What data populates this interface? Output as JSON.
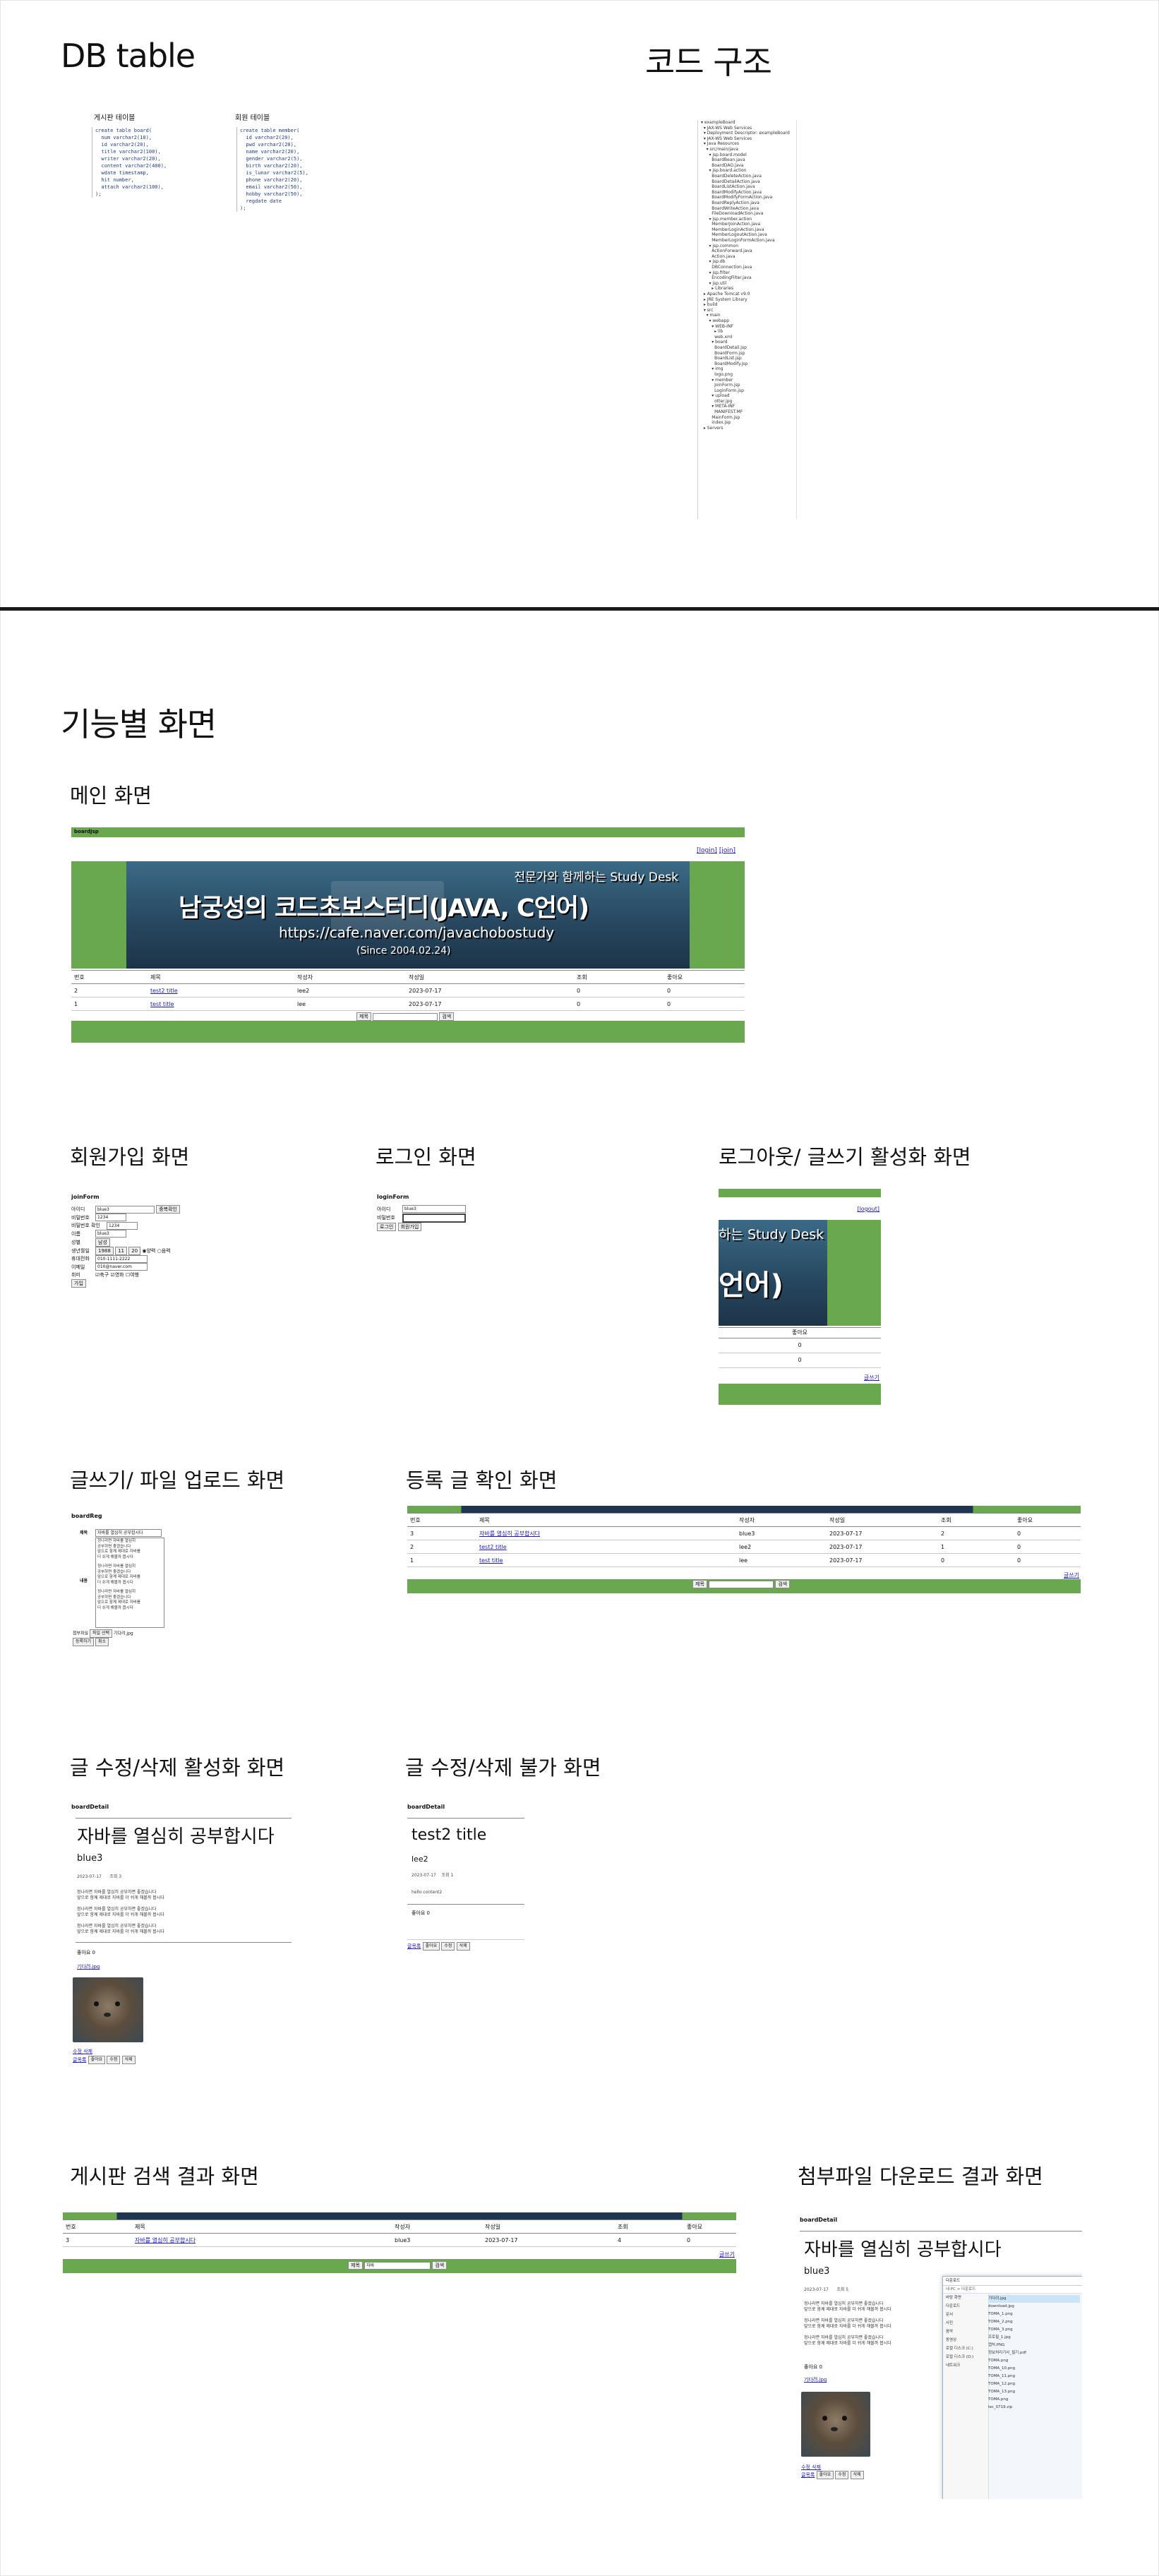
{
  "sections": {
    "db_title": "DB table",
    "code_title": "코드 구조",
    "feature_title": "기능별 화면",
    "main_screen": "메인 화면",
    "join_screen": "회원가입 화면",
    "login_screen": "로그인 화면",
    "logout_screen": "로그아웃/ 글쓰기 활성화 화면",
    "write_screen": "글쓰기/ 파일 업로드 화면",
    "registered_screen": "등록 글 확인 화면",
    "edit_enabled_screen": "글 수정/삭제 활성화  화면",
    "edit_disabled_screen": "글 수정/삭제 불가 화면",
    "search_screen": "게시판 검색 결과 화면",
    "download_screen": "첨부파일 다운로드 결과 화면"
  },
  "db": {
    "board_label": "게시판 테이블",
    "member_label": "회원 테이블",
    "board_sql": "create table board(\n  num varchar2(10),\n  id varchar2(20),\n  title varchar2(100),\n  writer varchar2(20),\n  content varchar2(400),\n  wdate timestamp,\n  hit number,\n  attach varchar2(100),\n);",
    "member_sql": "create table member(\n  id varchar2(20),\n  pwd varchar2(20),\n  name varchar2(20),\n  gender varchar2(5),\n  birth varchar2(20),\n  is_lunar varchar2(5),\n  phone varchar2(20),\n  email varchar2(50),\n  hobby varchar2(50),\n  regdate date\n);"
  },
  "code_tree": "▾ exampleBoard\n  ▾ JAX-WS Web Services\n  ▾ Deployment Descriptor: exampleBoard\n  ▾ JAX-WS Web Services\n  ▾ Java Resources\n    ▾ src/main/java\n      ▾ jsp.board.model\n        BoardBean.java\n        BoardDAO.java\n      ▾ jsp.board.action\n        BoardDeleteAction.java\n        BoardDetailAction.java\n        BoardListAction.java\n        BoardModifyAction.java\n        BoardModifyFormAction.java\n        BoardReplyAction.java\n        BoardWriteAction.java\n        FileDownloadAction.java\n      ▾ jsp.member.action\n        MemberJoinAction.java\n        MemberLoginAction.java\n        MemberLogoutAction.java\n        MemberLoginFormAction.java\n      ▾ jsp.common\n        ActionForward.java\n        Action.java\n      ▾ jsp.db\n        DBConnection.java\n      ▾ jsp.filter\n        EncodingFilter.java\n      ▾ jsp.util\n        ▸ Libraries\n  ▸ Apache Tomcat v9.0\n  ▸ JRE System Library\n  ▸ build\n  ▾ src\n    ▾ main\n      ▾ webapp\n        ▾ WEB-INF\n          ▸ lib\n          web.xml\n        ▾ board\n          BoardDetail.jsp\n          BoardForm.jsp\n          BoardList.jsp\n          BoardModify.jsp\n        ▾ img\n          logo.png\n        ▾ member\n          JoinForm.jsp\n          LoginForm.jsp\n        ▾ upload\n          otter.jpg\n        ▾ META-INF\n          MANIFEST.MF\n        MainForm.jsp\n        index.jsp\n  ▸ Servers",
  "main": {
    "brand": "boardJsp",
    "login_link": "[login]",
    "join_link": "[join]",
    "banner_tagline": "전문가와 함께하는 Study Desk",
    "banner_title": "남궁성의 코드초보스터디(JAVA, C언어)",
    "banner_url": "https://cafe.naver.com/javachobostudy",
    "banner_since": "(Since 2004.02.24)",
    "headers": [
      "번호",
      "제목",
      "작성자",
      "작성일",
      "조회",
      "좋아요"
    ],
    "rows": [
      [
        "2",
        "test2 title",
        "lee2",
        "2023-07-17",
        "0",
        "0"
      ],
      [
        "1",
        "test title",
        "lee",
        "2023-07-17",
        "0",
        "0"
      ]
    ],
    "search_select": "제목",
    "search_button": "검색"
  },
  "join": {
    "title": "joinForm",
    "id_label": "아이디",
    "id_value": "blue3",
    "dup_button": "중복확인",
    "pw_label": "비밀번호",
    "pw_value": "1234",
    "pw2_label": "비밀번호 확인",
    "pw2_value": "1234",
    "name_label": "이름",
    "name_value": "blue3",
    "gender_label": "성별",
    "gender_value": "남성",
    "birth_label": "생년월일",
    "birth_year": "1988",
    "birth_month": "11",
    "birth_day": "20",
    "solar": "양력",
    "lunar": "음력",
    "phone_label": "휴대전화",
    "phone_value": "010-1111-2222",
    "email_label": "이메일",
    "email_value": "010@naver.com",
    "hobby_label": "취미",
    "hobby_1": "축구",
    "hobby_2": "영화",
    "hobby_3": "여행",
    "submit": "가입"
  },
  "login": {
    "title": "loginForm",
    "id_label": "아이디",
    "id_value": "blue3",
    "pw_label": "비밀번호",
    "login_button": "로그인",
    "join_button": "회원가입"
  },
  "logout": {
    "logout_link": "[logout]",
    "banner_fragment": "하는 Study Desk",
    "banner_title_fragment": "언어)",
    "header": "좋아요",
    "vals": [
      "0",
      "0"
    ],
    "write_link": "글쓰기"
  },
  "write": {
    "title": "boardReg",
    "title_label": "제목",
    "title_value": "자바를 열심히 공부합시다",
    "content_label": "내용",
    "content_lines": [
      "정나라면 자바를 열심히",
      "공부하면 좋겠습니다",
      "앞으로 함께 제대로 자바를",
      "더 쉬게 해볼까 봅시다",
      "",
      "정나라면 자바를 열심히",
      "공부하면 좋겠습니다",
      "앞으로 함께 제대로 자바를",
      "더 쉬게 해볼까 봅시다",
      "",
      "정나라면 자바를 열심히",
      "공부하면 좋겠습니다",
      "앞으로 함께 제대로 자바를",
      "더 쉬게 해볼까 봅시다"
    ],
    "file_label": "첨부파일",
    "file_button": "파일 선택",
    "file_name": "기다려.jpg",
    "submit": "등록하기",
    "reset": "취소"
  },
  "registered": {
    "headers": [
      "번호",
      "제목",
      "작성자",
      "작성일",
      "조회",
      "좋아요"
    ],
    "rows": [
      [
        "3",
        "자바를 열심히 공부합시다",
        "blue3",
        "2023-07-17",
        "2",
        "0"
      ],
      [
        "2",
        "test2 title",
        "lee2",
        "2023-07-17",
        "1",
        "0"
      ],
      [
        "1",
        "test title",
        "lee",
        "2023-07-17",
        "0",
        "0"
      ]
    ],
    "write_link": "글쓰기",
    "search_select": "제목",
    "search_button": "검색"
  },
  "detail": {
    "title": "boardDetail",
    "post_title": "자바를 열심히 공부합시다",
    "writer": "blue3",
    "meta": "2023-07-17      조회 3",
    "body_lines": [
      "정나라면 자바를 열심히 공부하면 좋겠습니다",
      "앞으로 함께 제대로 자바를 더 쉬게 해볼까 봅시다",
      "",
      "정나라면 자바를 열심히 공부하면 좋겠습니다",
      "앞으로 함께 제대로 자바를 더 쉬게 해볼까 봅시다",
      "",
      "정나라면 자바를 열심히 공부하면 좋겠습니다",
      "앞으로 함께 제대로 자바를 더 쉬게 해볼까 봅시다"
    ],
    "likes": "좋아요 0",
    "attach": "기다려.jpg",
    "like_links": "수정 삭제",
    "bottom": "글목록",
    "btn_list": "좋아요",
    "btn_edit": "수정",
    "btn_del": "삭제"
  },
  "detail2": {
    "title": "boardDetail",
    "post_title": "test2 title",
    "writer": "lee2",
    "meta": "2023-07-17    조회 1",
    "body": "hello content2",
    "likes": "좋아요 0",
    "bottom": "글목록"
  },
  "search": {
    "headers": [
      "번호",
      "제목",
      "작성자",
      "작성일",
      "조회",
      "좋아요"
    ],
    "row": [
      "3",
      "자바를 열심히 공부합시다",
      "blue3",
      "2023-07-17",
      "4",
      "0"
    ],
    "write_link": "글쓰기",
    "search_select": "제목",
    "search_value": "자바",
    "search_button": "검색"
  },
  "download": {
    "title": "boardDetail",
    "post_title": "자바를 열심히 공부합시다",
    "writer": "blue3",
    "meta": "2023-07-17      조회 5",
    "explorer_title": "다운로드",
    "explorer_path": "내 PC > 다운로드",
    "files": [
      "기다려.jpg",
      "download.jpg",
      "TOMA_1.png",
      "TOMA_2.png",
      "TOMA_3.png",
      "프로필_1.jpg",
      "캡처.PNG",
      "정보처리기사_필기.pdf",
      "TOMA.png",
      "TOMA_10.png",
      "TOMA_11.png",
      "TOMA_12.png",
      "TOMA_13.png",
      "TOMA.png",
      "lec_0719.zip"
    ],
    "side_items": [
      "바탕 화면",
      "다운로드",
      "문서",
      "사진",
      "음악",
      "동영상",
      "로컬 디스크 (C:)",
      "로컬 디스크 (D:)",
      "네트워크"
    ]
  },
  "colors": {
    "green": "#6aa84f",
    "navy": "#1f3552",
    "link": "#1a1acc"
  }
}
